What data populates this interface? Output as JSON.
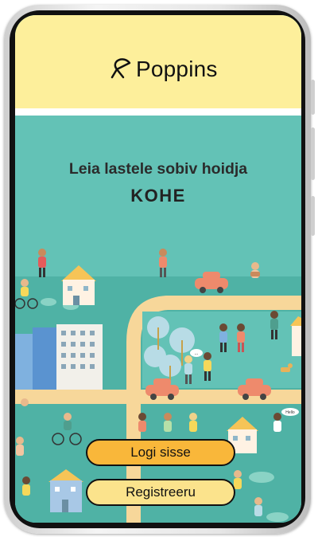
{
  "app": {
    "logo_text": "Poppins"
  },
  "hero": {
    "headline": "Leia lastele sobiv hoidja",
    "subline": "KOHE"
  },
  "actions": {
    "login_label": "Logi sisse",
    "register_label": "Registreeru"
  },
  "illustration": {
    "speech_bubble_1": "...",
    "speech_bubble_2": "Hello"
  },
  "colors": {
    "header_bg": "#fdef9b",
    "map_bg": "#63c2b6",
    "road": "#f7d79a",
    "login_button": "#f9b73a",
    "register_button": "#fbe38c"
  }
}
